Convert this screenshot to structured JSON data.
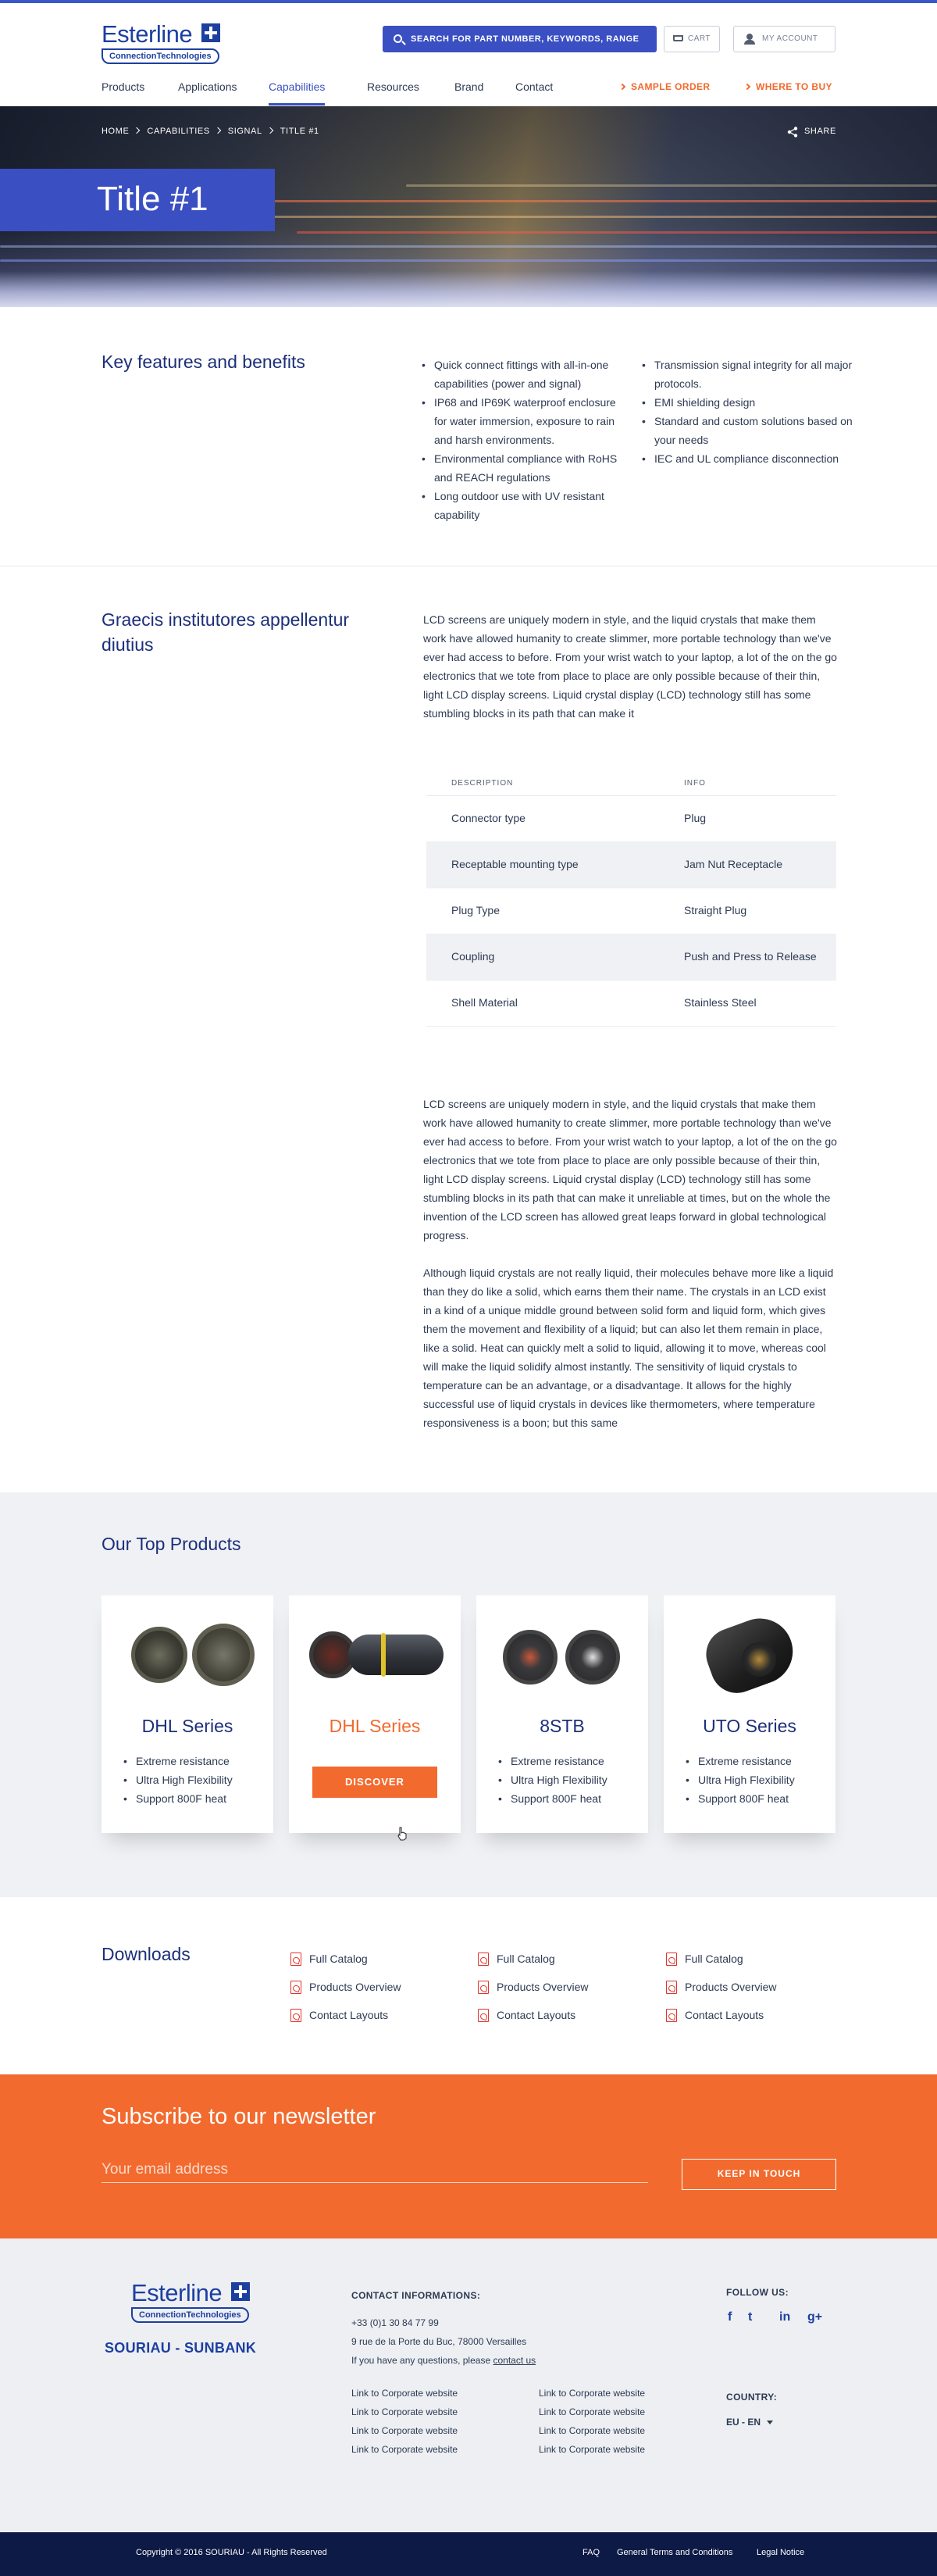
{
  "brand": {
    "logo_word": "Esterline",
    "logo_sub": "ConnectionTechnologies",
    "footer_brand": "SOURIAU - SUNBANK"
  },
  "header": {
    "search_label": "SEARCH FOR PART NUMBER, KEYWORDS, RANGE",
    "cart_label": "CART",
    "account_label": "MY ACCOUNT",
    "nav": [
      "Products",
      "Applications",
      "Capabilities",
      "Resources",
      "Brand",
      "Contact"
    ],
    "active_nav": "Capabilities",
    "quick_links": [
      "SAMPLE ORDER",
      "WHERE TO BUY"
    ]
  },
  "hero": {
    "breadcrumb": [
      "HOME",
      "CAPABILITIES",
      "SIGNAL",
      "TITLE #1"
    ],
    "share_label": "SHARE",
    "title": "Title #1"
  },
  "features": {
    "title": "Key features and benefits",
    "col1": [
      "Quick connect fittings with all-in-one capabilities (power and signal)",
      "IP68 and IP69K waterproof enclosure for water immersion, exposure to rain and harsh environments.",
      "Environmental compliance with RoHS and REACH regulations",
      "Long outdoor use with UV resistant capability"
    ],
    "col2": [
      "Transmission signal integrity for all major protocols.",
      "EMI shielding design",
      "Standard and custom solutions based on your needs",
      "IEC and UL compliance disconnection"
    ]
  },
  "info": {
    "title": "Graecis institutores appellentur diutius",
    "paragraph1": "LCD screens are uniquely modern in style, and the liquid crystals that make them work have allowed humanity to create slimmer, more portable technology than we've ever had access to before. From your wrist watch to your laptop, a lot of the on the go electronics that we tote from place to place are only possible because of their thin, light LCD display screens. Liquid crystal display (LCD) technology still has some stumbling blocks in its path that can make it",
    "table_headers": [
      "DESCRIPTION",
      "INFO"
    ],
    "table_rows": [
      [
        "Connector type",
        "Plug"
      ],
      [
        "Receptable mounting type",
        "Jam Nut Receptacle"
      ],
      [
        "Plug Type",
        "Straight Plug"
      ],
      [
        "Coupling",
        "Push and Press to Release"
      ],
      [
        "Shell Material",
        "Stainless Steel"
      ]
    ],
    "paragraph2": "LCD screens are uniquely modern in style, and the liquid crystals that make them work have allowed humanity to create slimmer, more portable technology than we've ever had access to before. From your wrist watch to your laptop, a lot of the on the go electronics that we tote from place to place are only possible because of their thin, light LCD display screens. Liquid crystal display (LCD) technology still has some stumbling blocks in its path that can make it unreliable at times, but on the whole the invention of the LCD screen has allowed great leaps forward in global technological progress.",
    "paragraph3": "Although liquid crystals are not really liquid, their molecules behave more like a liquid than they do like a solid, which earns them their name. The crystals in an LCD exist in a kind of a unique middle ground between solid form and liquid form, which gives them the movement and flexibility of a liquid; but can also let them remain in place, like a solid. Heat can quickly melt a solid to liquid, allowing it to move, whereas cool will make the liquid solidify almost instantly. The sensitivity of liquid crystals to temperature can be an advantage, or a disadvantage. It allows for the highly successful use of liquid crystals in devices like thermometers, where temperature responsiveness is a boon; but this same"
  },
  "products": {
    "title": "Our Top Products",
    "items": [
      {
        "name": "DHL Series",
        "features": [
          "Extreme resistance",
          "Ultra High Flexibility",
          "Support 800F heat"
        ]
      },
      {
        "name": "DHL Series",
        "button": "DISCOVER"
      },
      {
        "name": "8STB",
        "features": [
          "Extreme resistance",
          "Ultra High Flexibility",
          "Support 800F heat"
        ]
      },
      {
        "name": "UTO Series",
        "features": [
          "Extreme resistance",
          "Ultra High Flexibility",
          "Support 800F heat"
        ]
      }
    ]
  },
  "downloads": {
    "title": "Downloads",
    "columns": [
      [
        "Full Catalog",
        "Products Overview",
        "Contact Layouts"
      ],
      [
        "Full Catalog",
        "Products Overview",
        "Contact Layouts"
      ],
      [
        "Full Catalog",
        "Products Overview",
        "Contact Layouts"
      ]
    ]
  },
  "newsletter": {
    "title": "Subscribe to our newsletter",
    "placeholder": "Your email address",
    "button": "KEEP IN TOUCH"
  },
  "footer": {
    "contact_heading": "CONTACT INFORMATIONS:",
    "phone": "+33 (0)1 30 84 77 99",
    "address": "9 rue de la Porte du Buc, 78000 Versailles",
    "questions": "If you have any questions, please",
    "contact_link": "contact us",
    "links_col1": [
      "Link to Corporate website",
      "Link to Corporate website",
      "Link to Corporate website",
      "Link to Corporate website"
    ],
    "links_col2": [
      "Link to Corporate website",
      "Link to Corporate website",
      "Link to Corporate website",
      "Link to Corporate website"
    ],
    "follow_heading": "FOLLOW US:",
    "social": [
      "f",
      "t",
      "in",
      "g+"
    ],
    "country_heading": "COUNTRY:",
    "country_value": "EU - EN"
  },
  "bottom": {
    "copyright": "Copyright © 2016 SOURIAU - All Rights Reserved",
    "links": [
      "FAQ",
      "General Terms and Conditions",
      "Legal Notice"
    ]
  },
  "colors": {
    "primary_blue": "#3a4fc2",
    "brand_navy": "#1d3fa0",
    "accent_orange": "#f26a2e",
    "footer_dark": "#0d1a45"
  }
}
